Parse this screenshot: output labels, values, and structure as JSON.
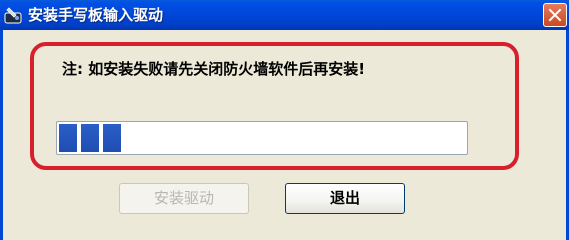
{
  "window": {
    "title": "安装手写板输入驱动",
    "icon": "tablet-pen-icon"
  },
  "notice": "注: 如安装失败请先关闭防火墙软件后再安装!",
  "progress": {
    "filled_segments": 3,
    "fraction": 0.14
  },
  "buttons": {
    "install_label": "安装驱动",
    "install_enabled": false,
    "exit_label": "退出"
  },
  "colors": {
    "titlebar": "#0046d8",
    "progress_fill": "#2a5ec8",
    "annotation": "#d8202c",
    "dialog_bg": "#ece9d8"
  }
}
